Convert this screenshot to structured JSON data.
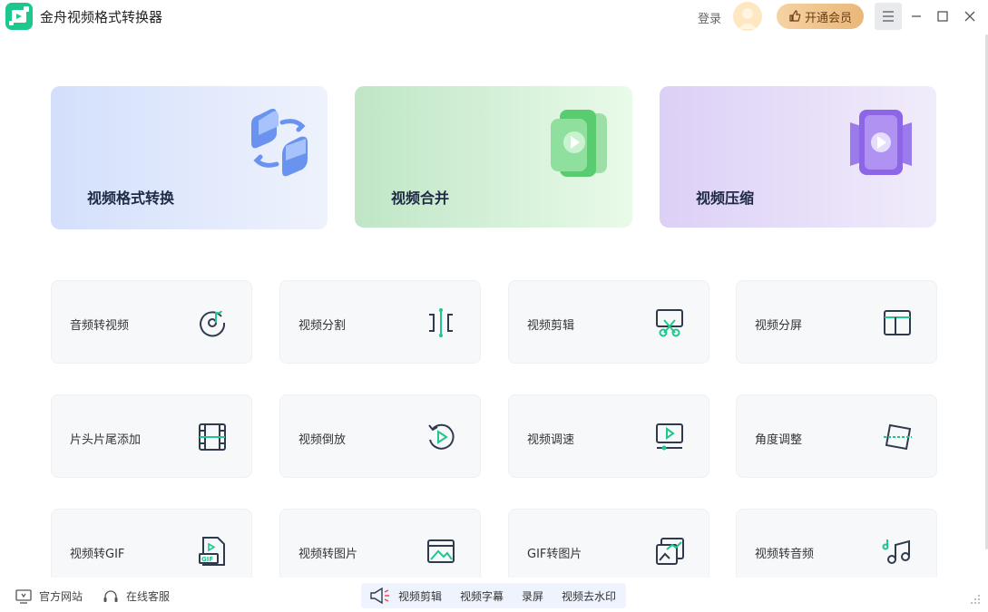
{
  "app": {
    "title": "金舟视频格式转换器"
  },
  "header": {
    "login_label": "登录",
    "vip_label": "开通会员"
  },
  "feature_cards": [
    {
      "label": "视频格式转换"
    },
    {
      "label": "视频合并"
    },
    {
      "label": "视频压缩"
    }
  ],
  "tools": [
    {
      "label": "音频转视频"
    },
    {
      "label": "视频分割"
    },
    {
      "label": "视频剪辑"
    },
    {
      "label": "视频分屏"
    },
    {
      "label": "片头片尾添加"
    },
    {
      "label": "视频倒放"
    },
    {
      "label": "视频调速"
    },
    {
      "label": "角度调整"
    },
    {
      "label": "视频转GIF"
    },
    {
      "label": "视频转图片"
    },
    {
      "label": "GIF转图片"
    },
    {
      "label": "视频转音频"
    }
  ],
  "footer": {
    "website_label": "官方网站",
    "support_label": "在线客服",
    "promo_items": [
      "视频剪辑",
      "视频字幕",
      "录屏",
      "视频去水印"
    ]
  },
  "colors": {
    "accent": "#1ec88c",
    "icon_dark": "#2f3b4c",
    "vip_gold": "#eab77a"
  }
}
